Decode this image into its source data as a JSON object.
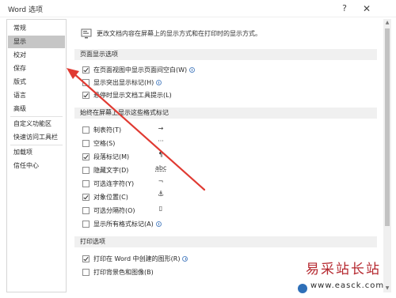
{
  "window": {
    "title": "Word 选项",
    "help_label": "?",
    "close_label": "✕"
  },
  "sidebar": {
    "items": [
      {
        "label": "常规"
      },
      {
        "label": "显示",
        "selected": true
      },
      {
        "label": "校对"
      },
      {
        "label": "保存"
      },
      {
        "label": "版式"
      },
      {
        "label": "语言"
      },
      {
        "label": "高级"
      },
      {
        "label": "自定义功能区"
      },
      {
        "label": "快速访问工具栏"
      },
      {
        "label": "加载项"
      },
      {
        "label": "信任中心"
      }
    ]
  },
  "content": {
    "intro": "更改文档内容在屏幕上的显示方式和在打印时的显示方式。",
    "sections": [
      {
        "title": "页面显示选项",
        "options": [
          {
            "label": "在页面视图中显示页面间空白(W)",
            "checked": true,
            "info": true
          },
          {
            "label": "显示突出显示标记(H)",
            "checked": false,
            "info": true
          },
          {
            "label": "悬停时显示文档工具提示(L)",
            "checked": true,
            "info": false
          }
        ]
      },
      {
        "title": "始终在屏幕上显示这些格式标记",
        "options": [
          {
            "label": "制表符(T)",
            "checked": false,
            "mark": "→"
          },
          {
            "label": "空格(S)",
            "checked": false,
            "mark": "···"
          },
          {
            "label": "段落标记(M)",
            "checked": true,
            "mark": "¶"
          },
          {
            "label": "隐藏文字(D)",
            "checked": false,
            "mark": "abc"
          },
          {
            "label": "可选连字符(Y)",
            "checked": false,
            "mark": "¬"
          },
          {
            "label": "对象位置(C)",
            "checked": true,
            "mark": "⚓"
          },
          {
            "label": "可选分隔符(O)",
            "checked": false,
            "mark": "▯"
          },
          {
            "label": "显示所有格式标记(A)",
            "checked": false,
            "info": true
          }
        ]
      },
      {
        "title": "打印选项",
        "options": [
          {
            "label": "打印在 Word 中创建的图形(R)",
            "checked": true,
            "info": true
          },
          {
            "label": "打印背景色和图像(B)",
            "checked": false
          }
        ]
      }
    ]
  },
  "watermark": {
    "title": "易采站长站",
    "url": "www.easck.com"
  },
  "colors": {
    "selected_nav": "#c6c6c6",
    "section_bg": "#f0f0f0",
    "annotation_arrow": "#e03a32",
    "watermark_red": "#b5282f"
  }
}
